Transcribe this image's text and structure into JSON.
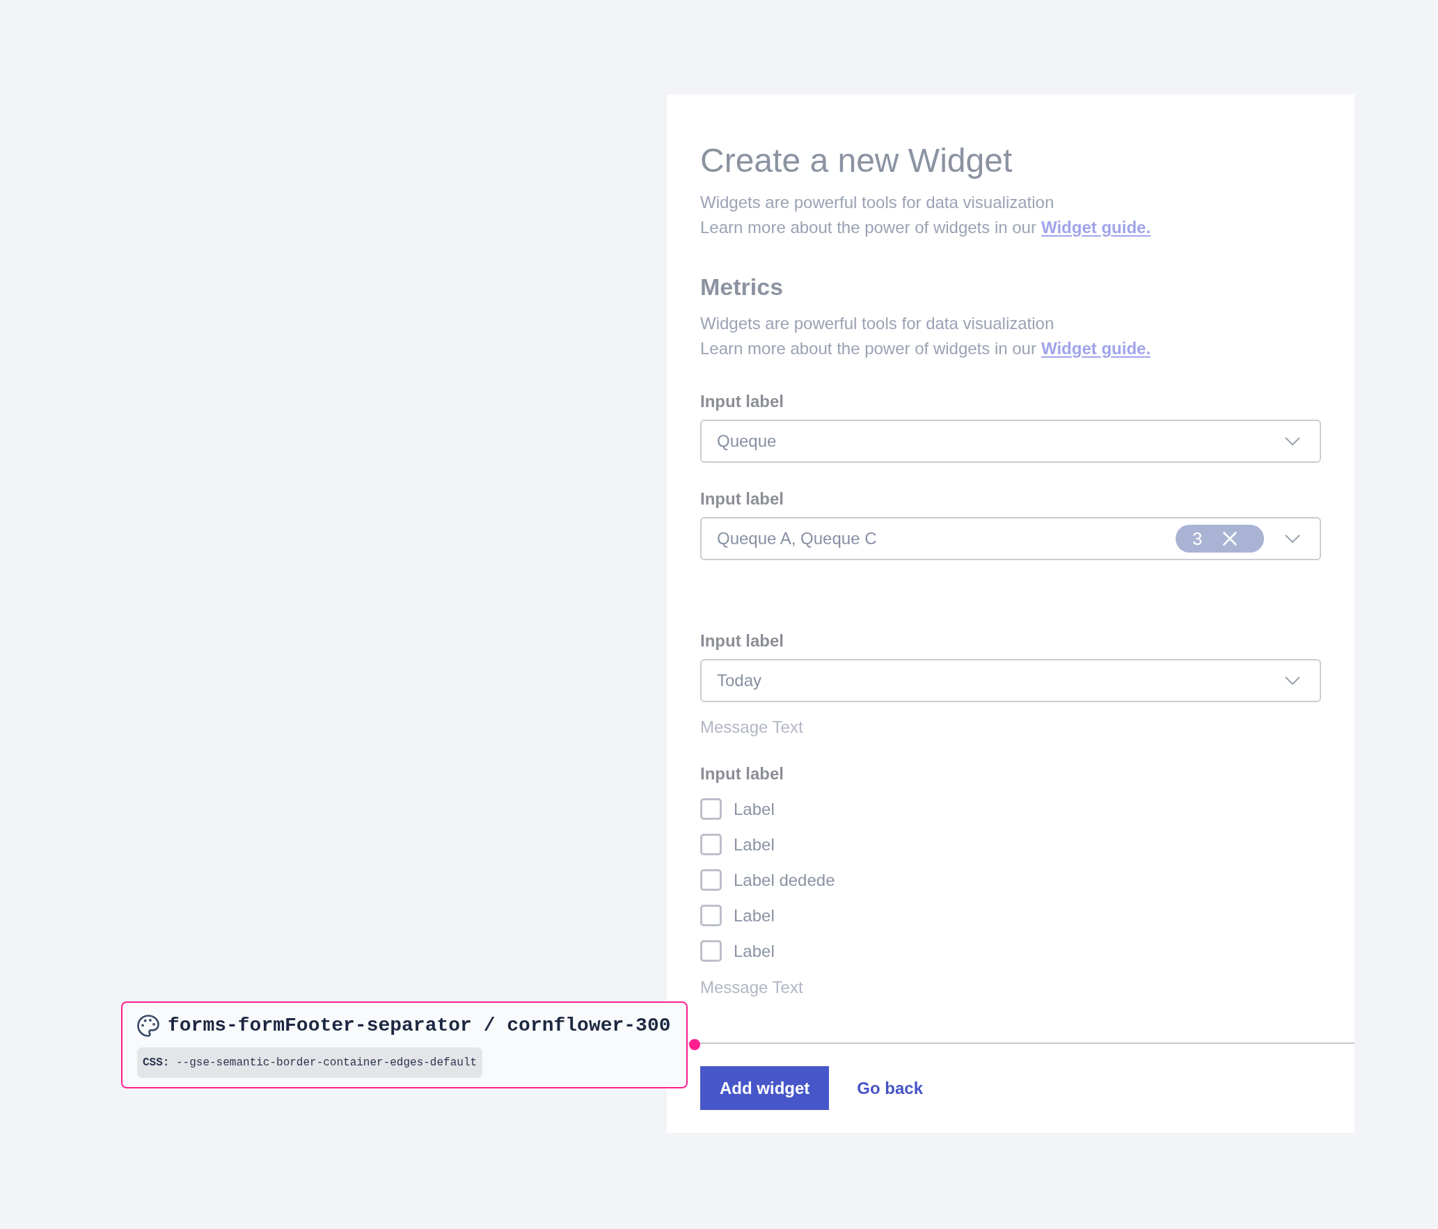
{
  "header": {
    "title": "Create a new Widget",
    "lines": [
      {
        "text": "Widgets are powerful tools for data visualization"
      },
      {
        "text": "Learn more about the power of widgets in our",
        "link": "Widget guide."
      }
    ]
  },
  "metrics": {
    "heading": "Metrics",
    "lines": [
      {
        "text": "Widgets are powerful tools for data visualization"
      },
      {
        "text": "Learn more about the power of widgets in our",
        "link": "Widget guide."
      }
    ]
  },
  "fields": [
    {
      "kind": "select",
      "label": "Input label",
      "value": "Queque"
    },
    {
      "kind": "multiselect",
      "label": "Input label",
      "value": "Queque A, Queque C",
      "count": "3"
    },
    {
      "kind": "select",
      "label": "Input label",
      "value": "Today",
      "message": "Message Text"
    },
    {
      "kind": "checkboxes",
      "label": "Input label",
      "options": [
        {
          "label": "Label",
          "checked": false
        },
        {
          "label": "Label",
          "checked": false
        },
        {
          "label": "Label dedede",
          "checked": false
        },
        {
          "label": "Label",
          "checked": false
        },
        {
          "label": "Label",
          "checked": false
        }
      ],
      "message": "Message Text"
    }
  ],
  "footer": {
    "buttons": [
      {
        "kind": "primary",
        "label": "Add widget"
      },
      {
        "kind": "link",
        "label": "Go back"
      }
    ]
  },
  "annotation": {
    "token": "forms-formFooter-separator / cornflower-300",
    "css": "**CSS:** --gse-semantic-border-container-edges-default"
  }
}
